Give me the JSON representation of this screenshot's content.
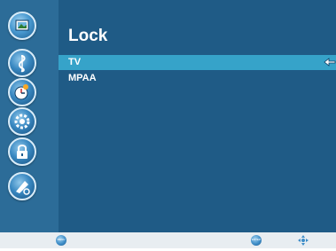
{
  "page": {
    "title": "Lock"
  },
  "sidebar": {
    "icons": [
      {
        "name": "picture-icon",
        "active": true
      },
      {
        "name": "music-icon",
        "active": false
      },
      {
        "name": "clock-icon",
        "active": false
      },
      {
        "name": "setup-gear-icon",
        "active": false
      },
      {
        "name": "lock-icon",
        "active": false
      },
      {
        "name": "channel-icon",
        "active": false
      }
    ]
  },
  "menu": {
    "items": [
      {
        "label": "TV",
        "selected": true
      },
      {
        "label": "MPAA",
        "selected": false
      }
    ]
  },
  "footer": {
    "menu_label": "MENU",
    "enter_label": "ENTER"
  },
  "colors": {
    "background": "#1f5b86",
    "sidebar": "#2c6c98",
    "highlight": "#36a3c9",
    "footer": "#e8edf1"
  }
}
